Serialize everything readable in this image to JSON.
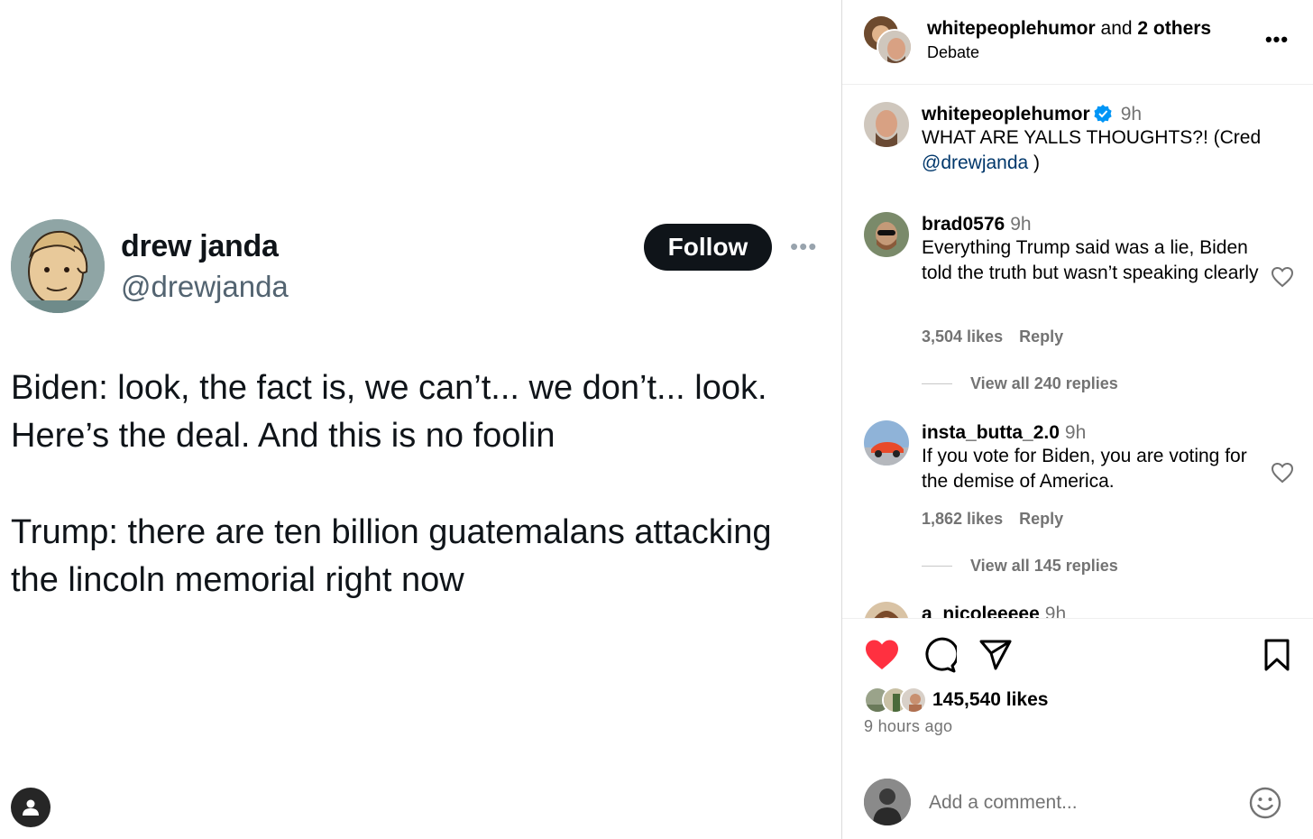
{
  "tweet": {
    "name": "drew janda",
    "handle": "@drewjanda",
    "follow_label": "Follow",
    "more_glyph": "•••",
    "paragraph1": "Biden: look, the fact is, we can’t... we don’t... look. Here’s the deal. And this is no foolin",
    "paragraph2": "Trump: there are ten billion guatemalans attacking the lincoln memorial right now"
  },
  "post": {
    "author": "whitepeoplehumor",
    "and_text": " and ",
    "others": "2 others",
    "subtitle": "Debate",
    "more_glyph": "•••"
  },
  "caption": {
    "user": "whitepeoplehumor",
    "time": "9h",
    "text": "WHAT ARE YALLS THOUGHTS?! (Cred ",
    "mention": "@drewjanda",
    "text_end": " )"
  },
  "comments": [
    {
      "user": "brad0576",
      "time": "9h",
      "text": "Everything Trump said was a lie, Biden told the truth but wasn’t speaking clearly",
      "likes": "3,504 likes",
      "reply": "Reply",
      "view_replies": "View all 240 replies"
    },
    {
      "user": "insta_butta_2.0",
      "time": "9h",
      "text": "If you vote for Biden, you are voting for the demise of America.",
      "likes": "1,862 likes",
      "reply": "Reply",
      "view_replies": "View all 145 replies"
    },
    {
      "user": "a_nicoleeeee",
      "time": "9h"
    }
  ],
  "actions": {
    "likes_count": "145,540 likes",
    "time_ago": "9 hours ago",
    "comment_placeholder": "Add a comment..."
  },
  "colors": {
    "like_red": "#ff3040",
    "verified_blue": "#0095f6",
    "follow_bg": "#0f1419",
    "secondary_text": "#737373",
    "handle_gray": "#536471"
  },
  "icons": [
    "user-icon",
    "heart-filled-icon",
    "comment-icon",
    "share-icon",
    "bookmark-icon",
    "heart-outline-icon",
    "verified-badge-icon",
    "emoji-icon",
    "more-icon"
  ]
}
